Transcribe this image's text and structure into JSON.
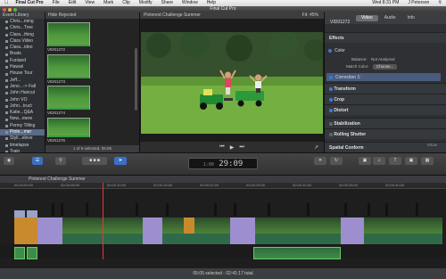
{
  "menubar": {
    "app": "Final Cut Pro",
    "items": [
      "File",
      "Edit",
      "View",
      "Mark",
      "Clip",
      "Modify",
      "Share",
      "Window",
      "Help"
    ],
    "clock": "Wed 8:31 PM",
    "user": "J Peterson"
  },
  "window": {
    "title": "Final Cut Pro"
  },
  "event_library": {
    "title": "Event Library",
    "items": [
      "Chris...ming",
      "Chris...Tree",
      "Clara...thing",
      "Clara Video",
      "Clara...ideo",
      "Boats",
      "Funland",
      "Hawaii",
      "House Tour",
      "Jeff...",
      "Jeno...-> Fall",
      "John Haircut",
      "John VO",
      "John...truct",
      "Katie...Q&A",
      "New...mere",
      "Penny Tilling",
      "Pinte...mer",
      "Styli...eleve",
      "timelapse",
      "Train"
    ],
    "selected_index": 17
  },
  "browser": {
    "filter": "Hide Rejected",
    "clips": [
      "VID01272",
      "VID01273",
      "VID01274",
      "VID01276"
    ],
    "footer": "1 of 9 selected, 05:05"
  },
  "viewer": {
    "title": "Pinterest Challenge Summer",
    "fit_label": "Fit:",
    "fit_value": "45%"
  },
  "inspector": {
    "tabs": [
      "Video",
      "Audio",
      "Info"
    ],
    "active_tab": "Video",
    "clip_id": "VID01272",
    "sections": [
      "Effects",
      "Transform",
      "Crop",
      "Distort",
      "Stabilization",
      "Rolling Shutter",
      "Spatial Conform"
    ],
    "color_label": "Color",
    "balance_label": "Balance:",
    "balance_value": "Not Analyzed",
    "match_label": "Match Color:",
    "match_button": "Choose...",
    "correction_label": "Correction 1:",
    "show": "Show"
  },
  "toolbar": {
    "timecode": "29:09",
    "timecode_prefix": "1:00"
  },
  "timeline": {
    "project": "Pinterest Challenge Summer",
    "ruler": [
      "00:00:00:00",
      "00:00:05:00",
      "00:00:10:00",
      "00:00:15:00",
      "00:00:20:00",
      "00:00:25:00",
      "00:00:30:00",
      "00:00:35:00",
      "00:00:40:00"
    ]
  },
  "status": {
    "text": "05:05 selected - 02:41:17 total"
  }
}
